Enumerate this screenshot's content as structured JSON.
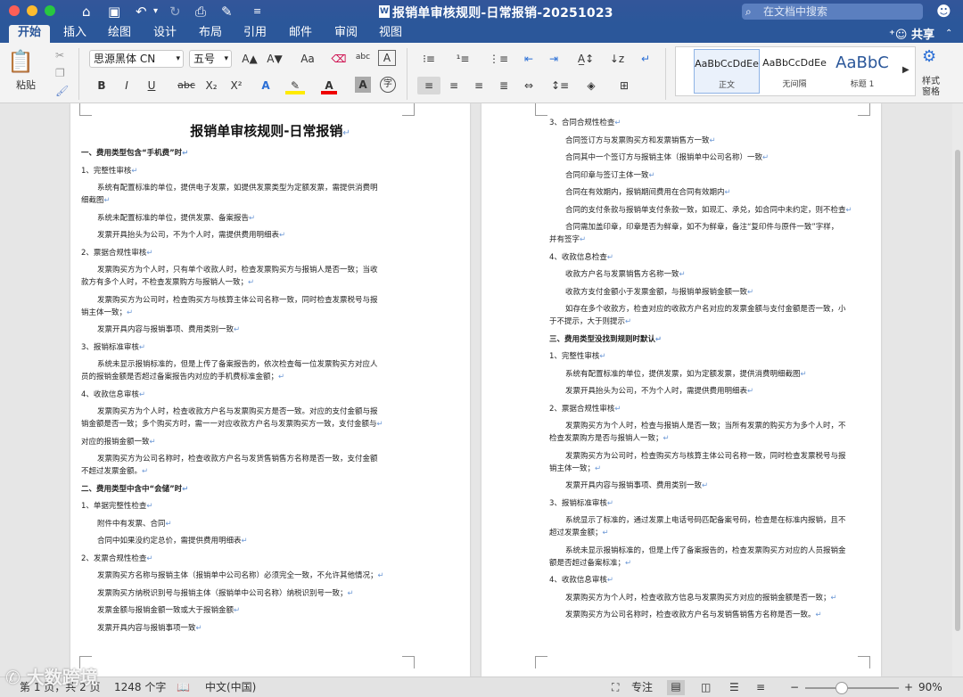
{
  "window": {
    "title": "报销单审核规则-日常报销-20251023",
    "file_icon": "word-doc-icon",
    "search_placeholder": "在文档中搜索"
  },
  "tabs": [
    "开始",
    "插入",
    "绘图",
    "设计",
    "布局",
    "引用",
    "邮件",
    "审阅",
    "视图"
  ],
  "share_label": "共享",
  "ribbon": {
    "paste_label": "粘贴",
    "font_name": "思源黑体 CN",
    "font_size": "五号",
    "bold": "B",
    "italic": "I",
    "underline": "U",
    "strike": "abc",
    "subscript": "X₂",
    "superscript": "X²",
    "grow": "A▲",
    "shrink": "A▼",
    "case": "Aa",
    "styles_pane_label": "样式\n窗格",
    "styles": [
      {
        "preview": "AaBbCcDdEe",
        "name": "正文"
      },
      {
        "preview": "AaBbCcDdEe",
        "name": "无间隔"
      },
      {
        "preview": "AaBbC",
        "name": "标题 1"
      }
    ]
  },
  "left_page": {
    "title": "报销单审核规则-日常报销",
    "lines": [
      {
        "t": "一、费用类型包含“手机费”时",
        "c": "h1",
        "i": 0
      },
      {
        "t": "1、完整性审核",
        "c": "",
        "i": 0
      },
      {
        "t": "系统有配置标准的单位，提供电子发票，如提供发票类型为定额发票，需提供消费明",
        "c": "",
        "i": 1
      },
      {
        "t": "细截图",
        "c": "",
        "i": 0
      },
      {
        "t": "系统未配置标准的单位，提供发票、备案报告",
        "c": "",
        "i": 1
      },
      {
        "t": "发票开具抬头为公司，不为个人时，需提供费用明细表",
        "c": "",
        "i": 1
      },
      {
        "t": "2、票据合规性审核",
        "c": "",
        "i": 0
      },
      {
        "t": "发票购买方为个人时，只有单个收款人时，检查发票购买方与报销人是否一致；当收",
        "c": "",
        "i": 1
      },
      {
        "t": "款方有多个人时，不检查发票购方与报销人一致；",
        "c": "",
        "i": 0
      },
      {
        "t": "发票购买方为公司时，检查购买方与核算主体公司名称一致，同时检查发票税号与报",
        "c": "",
        "i": 1
      },
      {
        "t": "销主体一致；",
        "c": "",
        "i": 0
      },
      {
        "t": "发票开具内容与报销事项、费用类别一致",
        "c": "",
        "i": 1
      },
      {
        "t": "3、报销标准审核",
        "c": "",
        "i": 0
      },
      {
        "t": "系统未显示报销标准的，但是上传了备案报告的，依次检查每一位发票购买方对应人",
        "c": "",
        "i": 1
      },
      {
        "t": "员的报销金额是否超过备案报告内对应的手机费标准金额；",
        "c": "",
        "i": 0
      },
      {
        "t": "4、收款信息审核",
        "c": "",
        "i": 0
      },
      {
        "t": "发票购买方为个人时，检查收款方户名与发票购买方是否一致。对应的支付金额与报",
        "c": "",
        "i": 1
      },
      {
        "t": "销金额是否一致；多个购买方时，需一一对应收款方户名与发票购买方一致，支付金额与",
        "c": "",
        "i": 0
      },
      {
        "t": "对应的报销金额一致",
        "c": "",
        "i": 0
      },
      {
        "t": "发票购买方为公司名称时，检查收款方户名与发货售销售方名称是否一致，支付金额",
        "c": "",
        "i": 1
      },
      {
        "t": "不超过发票金额。",
        "c": "",
        "i": 0
      },
      {
        "t": "二、费用类型中含中“会储”时",
        "c": "h1",
        "i": 0
      },
      {
        "t": "1、单据完整性检查",
        "c": "",
        "i": 0
      },
      {
        "t": "附件中有发票、合同",
        "c": "",
        "i": 1
      },
      {
        "t": "合同中如果没约定总价，需提供费用明细表",
        "c": "",
        "i": 1
      },
      {
        "t": "2、发票合规性检查",
        "c": "",
        "i": 0
      },
      {
        "t": "发票购买方名称与报销主体（报销单中公司名称）必须完全一致，不允许其他情况；",
        "c": "",
        "i": 1
      },
      {
        "t": "发票购买方纳税识别号与报销主体（报销单中公司名称）纳税识别号一致；",
        "c": "",
        "i": 1
      },
      {
        "t": "发票金额与报销金额一致或大于报销金额",
        "c": "",
        "i": 1
      },
      {
        "t": "发票开具内容与报销事项一致",
        "c": "",
        "i": 1
      }
    ]
  },
  "right_page": {
    "lines": [
      {
        "t": "3、合同合规性检查",
        "c": "",
        "i": 0
      },
      {
        "t": "合同签订方与发票购买方和发票销售方一致",
        "c": "",
        "i": 1
      },
      {
        "t": "合同其中一个签订方与报销主体（报销单中公司名称）一致",
        "c": "",
        "i": 1
      },
      {
        "t": "合同印章与签订主体一致",
        "c": "",
        "i": 1
      },
      {
        "t": "合同在有效期内，报销期间费用在合同有效期内",
        "c": "",
        "i": 1
      },
      {
        "t": "合同的支付条款与报销单支付条款一致，如现汇、承兑，如合同中未约定，则不检查",
        "c": "",
        "i": 1
      },
      {
        "t": "合同需加盖印章，印章是否为鲜章，如不为鲜章，备注“复印件与原件一致”字样，",
        "c": "",
        "i": 1
      },
      {
        "t": "并有签字",
        "c": "",
        "i": 0
      },
      {
        "t": "4、收款信息检查",
        "c": "",
        "i": 0
      },
      {
        "t": "收款方户名与发票销售方名称一致",
        "c": "",
        "i": 1
      },
      {
        "t": "收款方支付金额小于发票金额，与报销单报销金额一致",
        "c": "",
        "i": 1
      },
      {
        "t": "如存在多个收款方，检查对应的收款方户名对应的发票金额与支付金额是否一致，小",
        "c": "",
        "i": 1
      },
      {
        "t": "于不提示，大于则提示",
        "c": "",
        "i": 0
      },
      {
        "t": "三、费用类型没找到规则时默认",
        "c": "h1",
        "i": 0
      },
      {
        "t": "1、完整性审核",
        "c": "",
        "i": 0
      },
      {
        "t": "系统有配置标准的单位，提供发票，如为定额发票，提供消费明细截图",
        "c": "",
        "i": 1
      },
      {
        "t": "发票开具抬头为公司，不为个人时，需提供费用明细表",
        "c": "",
        "i": 1
      },
      {
        "t": "2、票据合规性审核",
        "c": "",
        "i": 0
      },
      {
        "t": "发票购买方为个人时，检查与报销人是否一致；当所有发票的购买方为多个人时，不",
        "c": "",
        "i": 1
      },
      {
        "t": "检查发票购方是否与报销人一致；",
        "c": "",
        "i": 0
      },
      {
        "t": "发票购买方为公司时，检查购买方与核算主体公司名称一致，同时检查发票税号与报",
        "c": "",
        "i": 1
      },
      {
        "t": "销主体一致；",
        "c": "",
        "i": 0
      },
      {
        "t": "发票开具内容与报销事项、费用类别一致",
        "c": "",
        "i": 1
      },
      {
        "t": "3、报销标准审核",
        "c": "",
        "i": 0
      },
      {
        "t": "系统显示了标准的，通过发票上电话号码匹配备案号码，检查是在标准内报销，且不",
        "c": "",
        "i": 1
      },
      {
        "t": "超过发票金额；",
        "c": "",
        "i": 0
      },
      {
        "t": "系统未显示报销标准的，但是上传了备案报告的，检查发票购买方对应的人员报销金",
        "c": "",
        "i": 1
      },
      {
        "t": "额是否超过备案标准；",
        "c": "",
        "i": 0
      },
      {
        "t": "4、收款信息审核",
        "c": "",
        "i": 0
      },
      {
        "t": "发票购买方为个人时，检查收款方信息与发票购买方对应的报销金额是否一致；",
        "c": "",
        "i": 1
      },
      {
        "t": "发票购买方为公司名称时，检查收款方户名与发销售销售方名称是否一致。",
        "c": "",
        "i": 1
      }
    ]
  },
  "status": {
    "page": "第 1 页，共 2 页",
    "words": "1248 个字",
    "language": "中文(中国)",
    "focus": "专注",
    "zoom": "90%"
  },
  "watermark": "大数跨境"
}
